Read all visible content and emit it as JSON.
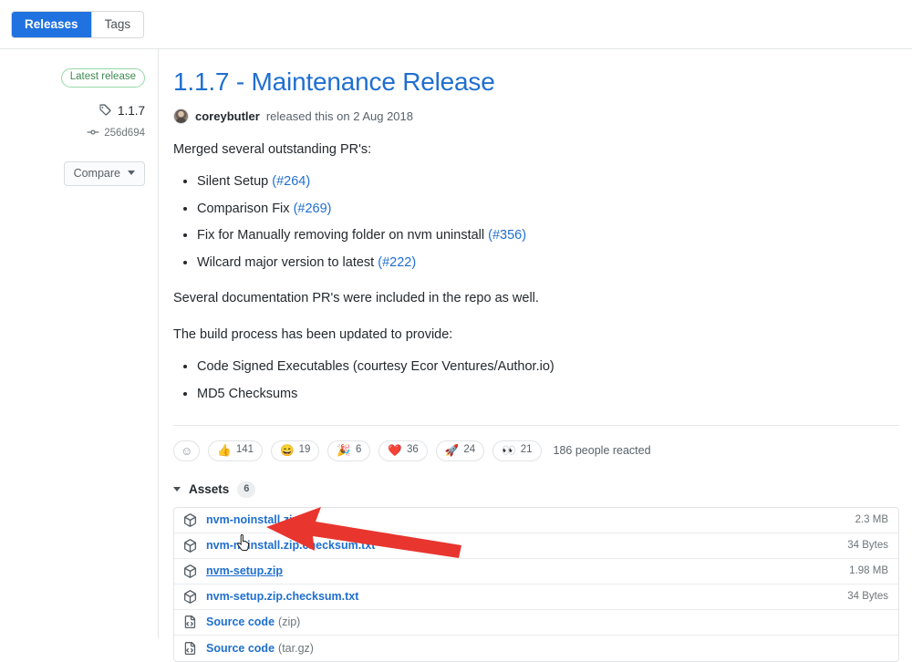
{
  "tabs": [
    {
      "label": "Releases",
      "selected": true
    },
    {
      "label": "Tags",
      "selected": false
    }
  ],
  "sidebar": {
    "latest_badge": "Latest release",
    "tag_icon": "tag-icon",
    "tag": "1.1.7",
    "commit_icon": "commit-icon",
    "commit": "256d694",
    "compare_label": "Compare",
    "compare_caret": "chevron-down-icon"
  },
  "release": {
    "title": "1.1.7 - Maintenance Release",
    "author": "coreybutler",
    "byline_suffix": "released this on 2 Aug 2018",
    "intro": "Merged several outstanding PR's:",
    "pr_items": [
      {
        "text": "Silent Setup",
        "ref": "(#264)"
      },
      {
        "text": "Comparison Fix",
        "ref": "(#269)"
      },
      {
        "text": "Fix for Manually removing folder on nvm uninstall",
        "ref": "(#356)"
      },
      {
        "text": "Wilcard major version to latest",
        "ref": "(#222)"
      }
    ],
    "docs_note": "Several documentation PR's were included in the repo as well.",
    "build_note": "The build process has been updated to provide:",
    "build_items": [
      {
        "text": "Code Signed Executables (courtesy Ecor Ventures/Author.io)"
      },
      {
        "text": "MD5 Checksums"
      }
    ]
  },
  "reactions": {
    "add_label": "add-reaction",
    "items": [
      {
        "emoji": "👍",
        "name": "thumbs-up",
        "count": "141"
      },
      {
        "emoji": "😄",
        "name": "laugh",
        "count": "19"
      },
      {
        "emoji": "🎉",
        "name": "hooray",
        "count": "6"
      },
      {
        "emoji": "❤️",
        "name": "heart",
        "count": "36"
      },
      {
        "emoji": "🚀",
        "name": "rocket",
        "count": "24"
      },
      {
        "emoji": "👀",
        "name": "eyes",
        "count": "21"
      }
    ],
    "summary": "186 people reacted"
  },
  "assets": {
    "label": "Assets",
    "count": "6",
    "rows": [
      {
        "icon": "package-icon",
        "name": "nvm-noinstall.zip",
        "suffix": "",
        "size": "2.3 MB",
        "hovered": false
      },
      {
        "icon": "package-icon",
        "name": "nvm-noinstall.zip.checksum.txt",
        "suffix": "",
        "size": "34 Bytes",
        "hovered": false
      },
      {
        "icon": "package-icon",
        "name": "nvm-setup.zip",
        "suffix": "",
        "size": "1.98 MB",
        "hovered": true
      },
      {
        "icon": "package-icon",
        "name": "nvm-setup.zip.checksum.txt",
        "suffix": "",
        "size": "34 Bytes",
        "hovered": false
      },
      {
        "icon": "file-code-icon",
        "name": "Source code",
        "suffix": "(zip)",
        "size": "",
        "hovered": false
      },
      {
        "icon": "file-code-icon",
        "name": "Source code",
        "suffix": "(tar.gz)",
        "size": "",
        "hovered": false
      }
    ]
  },
  "annotation": {
    "arrow_color": "#e8352e",
    "arrow_target": "nvm-setup.zip",
    "cursor": "pointer-hand-cursor"
  },
  "colors": {
    "accent_blue": "#1f6fcf",
    "tab_blue": "#1f72e0",
    "link": "#1f6fcf",
    "green_badge": "#3d8a52",
    "muted": "#6d7479",
    "border": "#e2e4e7"
  }
}
